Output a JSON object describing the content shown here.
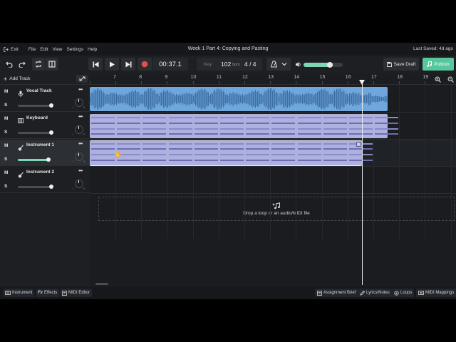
{
  "menu": {
    "exit": "Exit",
    "items": [
      "File",
      "Edit",
      "View",
      "Settings",
      "Help"
    ],
    "title": "Week 1 Part 4: Copying and Pasting",
    "last_saved": "Last Saved: 4d ago"
  },
  "toolbar": {
    "time": "00:37.1",
    "key_label": "Key",
    "bpm": "102",
    "bpm_unit": "bpm",
    "time_signature": "4 / 4",
    "master_volume": 0.68,
    "save_draft": "Save Draft",
    "publish": "Publish"
  },
  "ruler": {
    "add_track": "Add Track",
    "bars": [
      "7",
      "8",
      "9",
      "10",
      "11",
      "12",
      "13",
      "14",
      "15",
      "16",
      "17",
      "18",
      "19"
    ]
  },
  "tracks": [
    {
      "name": "Vocal Track",
      "icon": "microphone-icon",
      "mute": "M",
      "solo": "S",
      "volume": 0.75,
      "selected": false
    },
    {
      "name": "Keyboard",
      "icon": "piano-keys-icon",
      "mute": "M",
      "solo": "S",
      "volume": 0.75,
      "selected": false
    },
    {
      "name": "Instrument 1",
      "icon": "guitar-icon",
      "mute": "M",
      "solo": "S",
      "volume": 0.7,
      "selected": true
    },
    {
      "name": "Instrument 2",
      "icon": "guitar-icon",
      "mute": "M",
      "solo": "S",
      "volume": 0.75,
      "selected": false
    }
  ],
  "pan_labels": {
    "left": "L",
    "right": "R"
  },
  "drop_zone": {
    "text": "Drop a loop or an audio/MIDI file"
  },
  "bottom": {
    "left": [
      "Instrument",
      "Effects",
      "MIDI Editor"
    ],
    "right": [
      "Assignment Brief",
      "Lyrics/Notes",
      "Loops",
      "MIDI Mappings"
    ],
    "fx_prefix": "Fx"
  },
  "colors": {
    "accent": "#57c79e",
    "audio_region": "#6fa7dc",
    "midi_region": "#aeb0e0",
    "record": "#e0504a"
  }
}
